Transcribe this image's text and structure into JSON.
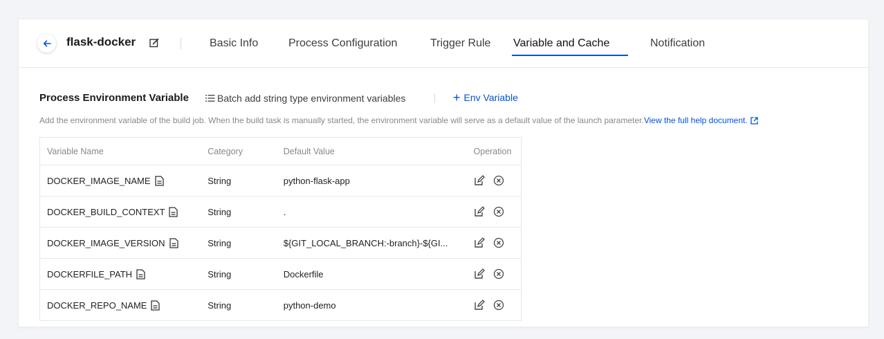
{
  "project": {
    "title": "flask-docker"
  },
  "tabs": [
    {
      "label": "Basic Info"
    },
    {
      "label": "Process Configuration"
    },
    {
      "label": "Trigger Rule"
    },
    {
      "label": "Variable and Cache",
      "active": true
    },
    {
      "label": "Notification"
    }
  ],
  "section": {
    "title": "Process Environment Variable",
    "batch_label": "Batch add string type environment variables",
    "add_label": "Env Variable",
    "add_icon": "plus-icon",
    "description": "Add the environment variable of the build job. When the build task is manually started, the environment variable will serve as a default value of the launch parameter.",
    "help_link": "View the full help document."
  },
  "table": {
    "headers": {
      "name": "Variable Name",
      "category": "Category",
      "default": "Default Value",
      "operation": "Operation"
    },
    "rows": [
      {
        "name": "DOCKER_IMAGE_NAME",
        "category": "String",
        "default": "python-flask-app"
      },
      {
        "name": "DOCKER_BUILD_CONTEXT",
        "category": "String",
        "default": "."
      },
      {
        "name": "DOCKER_IMAGE_VERSION",
        "category": "String",
        "default": "${GIT_LOCAL_BRANCH:-branch}-${GI..."
      },
      {
        "name": "DOCKERFILE_PATH",
        "category": "String",
        "default": "Dockerfile"
      },
      {
        "name": "DOCKER_REPO_NAME",
        "category": "String",
        "default": "python-demo"
      }
    ]
  },
  "colors": {
    "accent": "#0052d9",
    "muted_text": "#888888",
    "border": "#e5e7eb"
  },
  "icons": {
    "back": "arrow-left-icon",
    "edit_title": "edit-icon",
    "batch": "list-icon",
    "help_external": "external-link-icon",
    "variable_doc": "document-icon",
    "row_edit": "edit-icon",
    "row_delete": "close-circle-icon"
  }
}
